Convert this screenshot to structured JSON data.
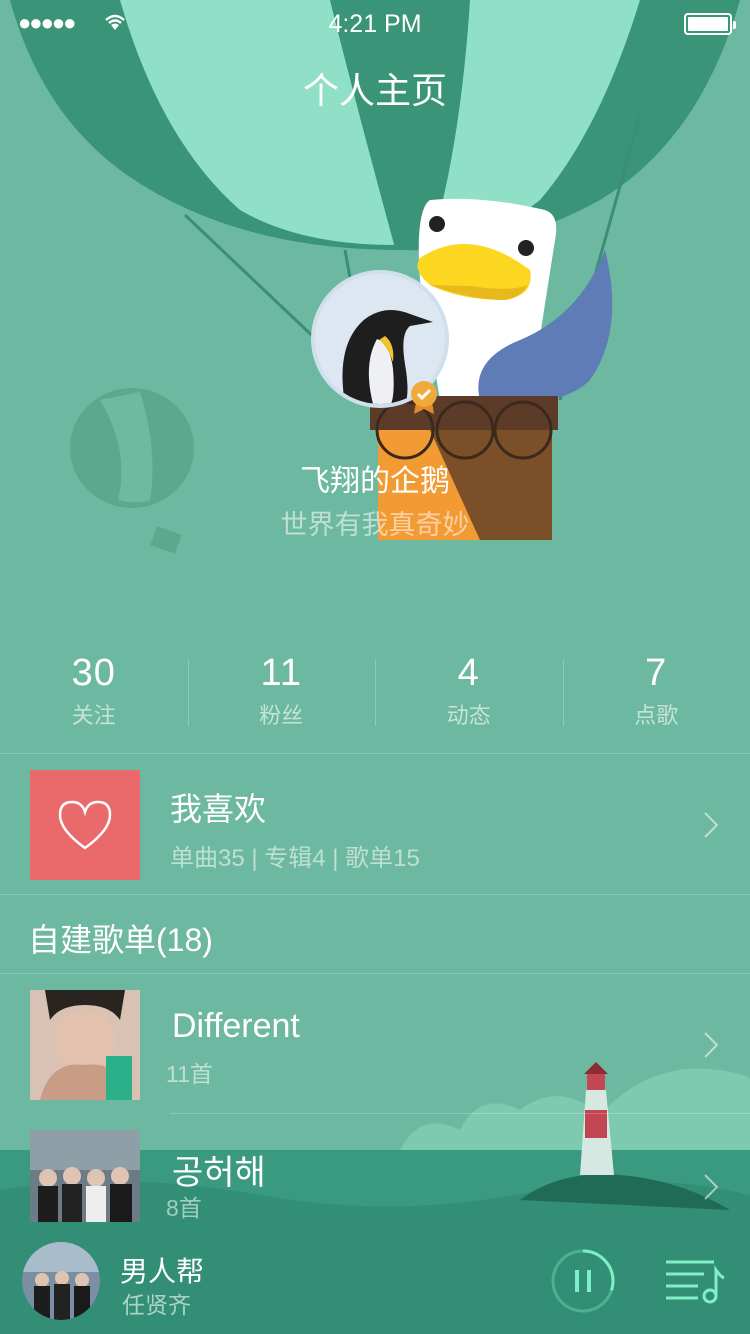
{
  "status_bar": {
    "signal": "●●●●●",
    "time": "4:21 PM"
  },
  "header": {
    "title": "个人主页"
  },
  "profile": {
    "name": "飞翔的企鹅",
    "motto": "世界有我真奇妙"
  },
  "stats": [
    {
      "value": "30",
      "label": "关注"
    },
    {
      "value": "11",
      "label": "粉丝"
    },
    {
      "value": "4",
      "label": "动态"
    },
    {
      "value": "7",
      "label": "点歌"
    }
  ],
  "favorites": {
    "title": "我喜欢",
    "subtitle": "单曲35 | 专辑4 | 歌单15"
  },
  "playlists_section": {
    "title": "自建歌单(18)"
  },
  "playlists": [
    {
      "title": "Different",
      "count": "11首"
    },
    {
      "title": "공허해",
      "count": "8首"
    }
  ],
  "player": {
    "title": "男人帮",
    "artist": "任贤齐",
    "progress": 0.3
  },
  "colors": {
    "background": "#6db8a0",
    "accent": "#7ff0c6",
    "favorite_cover": "#ea6a6c"
  }
}
